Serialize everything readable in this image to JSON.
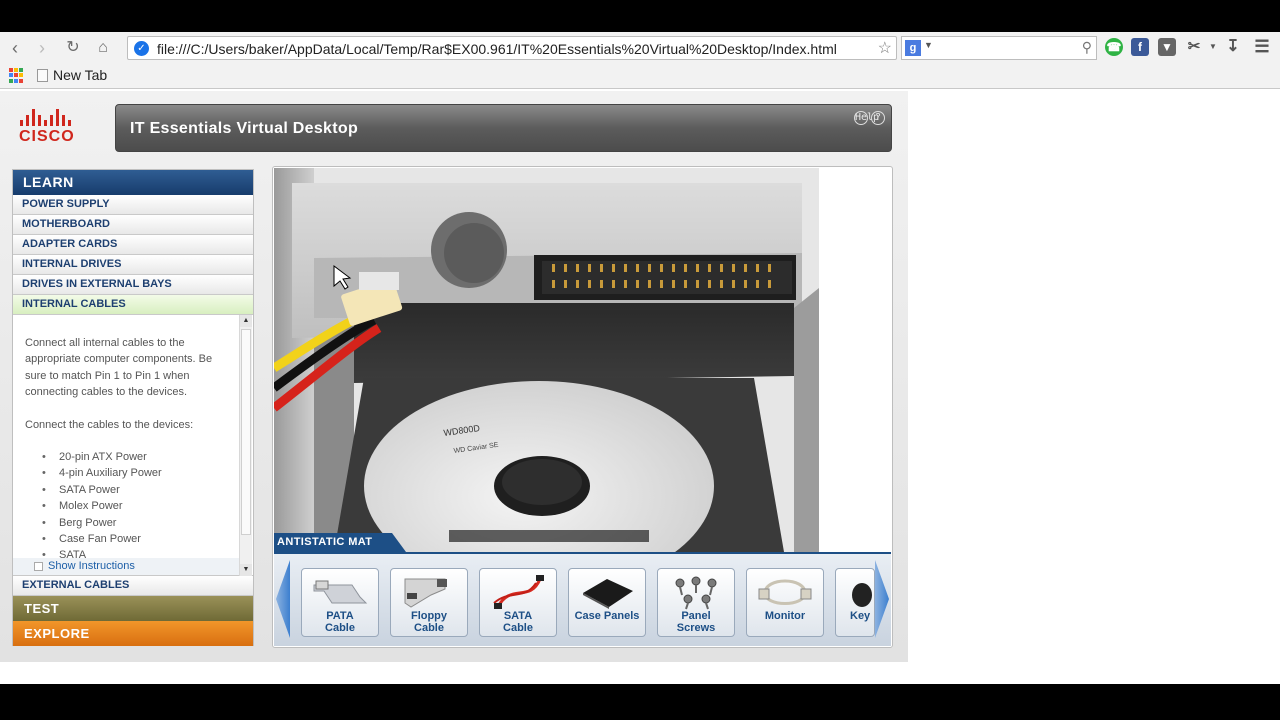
{
  "browser": {
    "url": "file:///C:/Users/baker/AppData/Local/Temp/Rar$EX00.961/IT%20Essentials%20Virtual%20Desktop/Index.html",
    "search_engine_badge": "g",
    "bookmarks": [
      "New Tab"
    ]
  },
  "app": {
    "logo_text": "CISCO",
    "title": "IT Essentials Virtual Desktop",
    "help_label": "Help",
    "help_icon": "?"
  },
  "menu": {
    "learn": "LEARN",
    "items": [
      "POWER SUPPLY",
      "MOTHERBOARD",
      "ADAPTER CARDS",
      "INTERNAL DRIVES",
      "DRIVES IN EXTERNAL BAYS",
      "INTERNAL CABLES"
    ],
    "active_index": 5,
    "instructions_p1": "Connect all internal cables to the appropriate computer components. Be sure to match Pin 1 to Pin 1 when connecting cables to the devices.",
    "instructions_p2": "Connect the cables to the devices:",
    "cable_list": [
      "20-pin ATX Power",
      "4-pin Auxiliary Power",
      "SATA Power",
      "Molex Power",
      "Berg Power",
      "Case Fan Power",
      "SATA"
    ],
    "show_instructions": "Show Instructions",
    "external_cables": "EXTERNAL CABLES",
    "test": "TEST",
    "explore": "EXPLORE"
  },
  "scene": {
    "hdd_label": "WD800D",
    "hdd_brand": "WD Caviar SE"
  },
  "tray": {
    "mat_label": "ANTISTATIC MAT",
    "tiles": [
      {
        "line1": "PATA",
        "line2": "Cable",
        "icon": "pata-cable-icon"
      },
      {
        "line1": "Floppy",
        "line2": "Cable",
        "icon": "floppy-cable-icon"
      },
      {
        "line1": "SATA",
        "line2": "Cable",
        "icon": "sata-cable-icon"
      },
      {
        "line1": "Case Panels",
        "line2": "",
        "icon": "case-panels-icon"
      },
      {
        "line1": "Panel",
        "line2": "Screws",
        "icon": "panel-screws-icon"
      },
      {
        "line1": "Monitor",
        "line2": "",
        "icon": "monitor-icon"
      },
      {
        "line1": "Key",
        "line2": "",
        "icon": "keyboard-icon"
      }
    ]
  },
  "colors": {
    "learn_blue": "#173c6c",
    "test_olive": "#7f7941",
    "explore_orange": "#e57d16",
    "cisco_red": "#d0271d",
    "tray_blue": "#1d4f86"
  }
}
